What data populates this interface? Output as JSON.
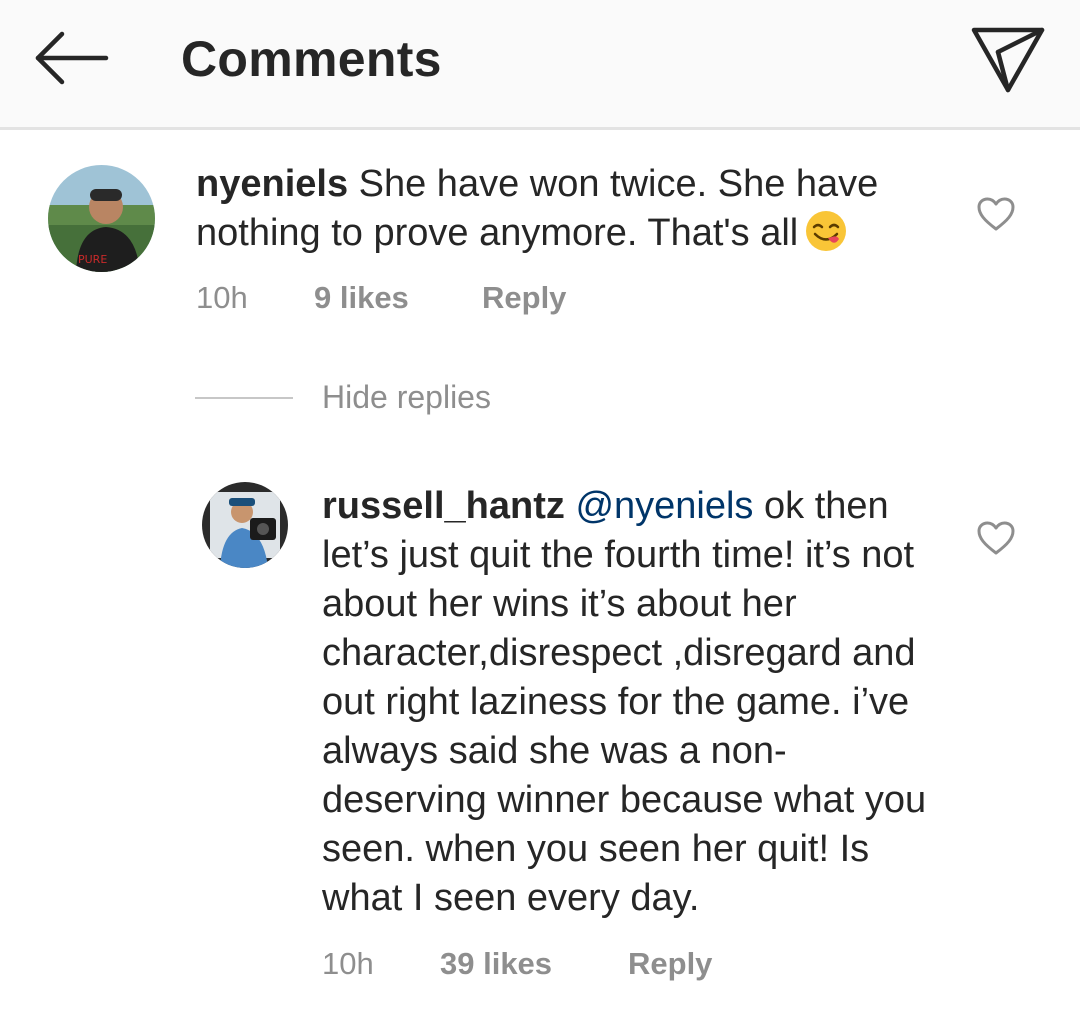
{
  "header": {
    "title": "Comments",
    "back_icon": "arrow-left-icon",
    "share_icon": "paper-plane-icon"
  },
  "comments": [
    {
      "username": "nyeniels",
      "text": "She have won twice. She have nothing to prove anymore. That's all",
      "emoji": "😋",
      "time": "10h",
      "likes": "9 likes",
      "reply_label": "Reply",
      "hide_replies_label": "Hide replies"
    },
    {
      "username": "russell_hantz",
      "mention": "@nyeniels",
      "text": "ok then let’s just quit the fourth time! it’s not about her wins it’s about her character,disrespect ,disregard and out right laziness for the game. i’ve always said she was a non-deserving winner because what you seen. when you seen her quit! Is what I seen every day.",
      "time": "10h",
      "likes": "39 likes",
      "reply_label": "Reply"
    }
  ],
  "colors": {
    "text": "#262626",
    "meta": "#8e8e8e",
    "mention": "#003569",
    "header_bg": "#fafafa"
  }
}
